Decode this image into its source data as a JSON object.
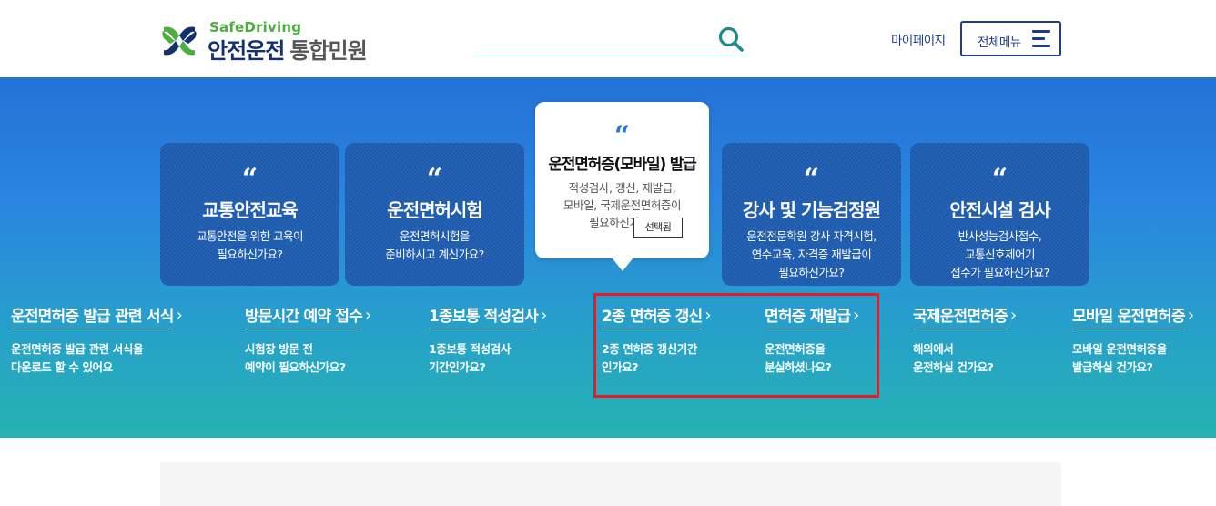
{
  "logo": {
    "sub": "SafeDriving",
    "main": "안전운전",
    "suffix": "통합민원"
  },
  "search": {
    "placeholder": "",
    "value": ""
  },
  "header": {
    "mypage": "마이페이지",
    "menu": "전체메뉴"
  },
  "cards": [
    {
      "title": "교통안전교육",
      "desc": "교통안전을 위한 교육이\n필요하신가요?"
    },
    {
      "title": "운전면허시험",
      "desc": "운전면허시험을\n준비하시고 계신가요?"
    },
    {
      "title": "운전면허증(모바일) 발급",
      "desc": "적성검사, 갱신, 재발급,\n모바일, 국제운전면허증이\n필요하신가요?",
      "selected": true
    },
    {
      "title": "강사 및 기능검정원",
      "desc": "운전전문학원 강사 자격시험,\n연수교육, 자격증 재발급이\n필요하신가요?"
    },
    {
      "title": "안전시설 검사",
      "desc": "반사성능검사접수,\n교통신호제어기\n접수가 필요하신가요?"
    }
  ],
  "selected_tip": "선택됨",
  "quick_links": [
    {
      "title": "운전면허증 발급 관련 서식",
      "desc": "운전면허증 발급 관련 서식을\n다운로드 할 수 있어요"
    },
    {
      "title": "방문시간 예약 접수",
      "desc": "시험장 방문 전\n예약이 필요하신가요?"
    },
    {
      "title": "1종보통 적성검사",
      "desc": "1종보통 적성검사\n기간인가요?"
    },
    {
      "title": "2종 면허증 갱신",
      "desc": "2종 면허증 갱신기간\n인가요?"
    },
    {
      "title": "면허증 재발급",
      "desc": "운전면허증을\n분실하셨나요?"
    },
    {
      "title": "국제운전면허증",
      "desc": "해외에서\n운전하실 건가요?"
    },
    {
      "title": "모바일 운전면허증",
      "desc": "모바일 운전면허증을\n발급하실 건가요?"
    }
  ],
  "colors": {
    "brand_navy": "#1e3d86",
    "brand_green": "#4cae3e",
    "highlight": "#e01e25"
  },
  "icons": {
    "search": "search-icon",
    "menu": "hamburger-icon",
    "quote": "quote-icon",
    "arrow": "chevron-right-icon"
  }
}
